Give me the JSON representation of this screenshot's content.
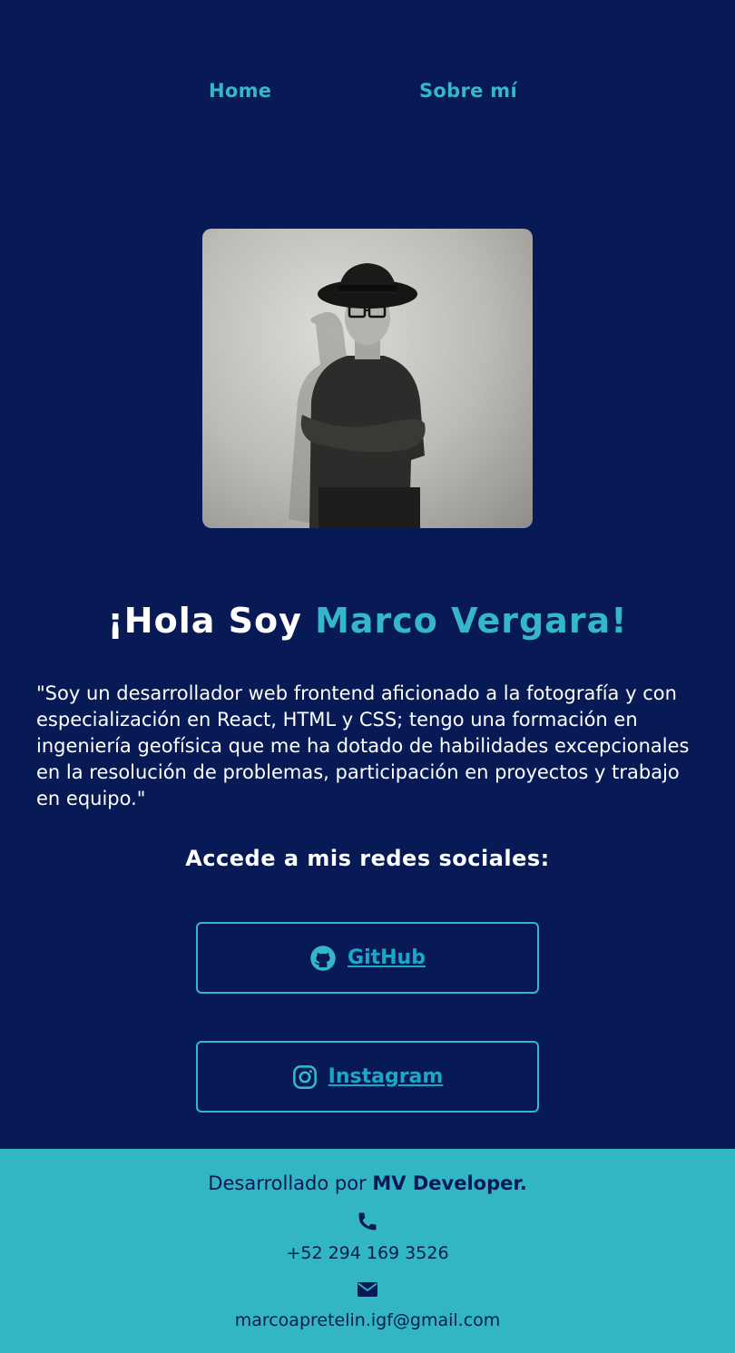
{
  "nav": {
    "home_label": "Home",
    "about_label": "Sobre mí"
  },
  "hero": {
    "title_prefix": "¡Hola Soy ",
    "title_name": "Marco Vergara!",
    "bio": "\"Soy un desarrollador web frontend aficionado a la fotografía y con especialización en React, HTML y CSS; tengo una formación en ingeniería geofísica que me ha dotado de habilidades excepcionales en la resolución de problemas, participación en proyectos y trabajo en equipo.\""
  },
  "social": {
    "heading": "Accede a mis redes sociales:",
    "github_label": "GitHub",
    "github_icon": "github-icon",
    "instagram_label": "Instagram",
    "instagram_icon": "instagram-icon"
  },
  "footer": {
    "credit_prefix": "Desarrollado por ",
    "credit_brand": "MV Developer.",
    "phone": "+52 294 169 3526",
    "phone_icon": "phone-icon",
    "email": "marcoapretelin.igf@gmail.com",
    "email_icon": "envelope-icon"
  },
  "colors": {
    "background": "#071a56",
    "accent": "#35b7c7",
    "footer_bg": "#33b6c4",
    "text": "#ffffff"
  }
}
